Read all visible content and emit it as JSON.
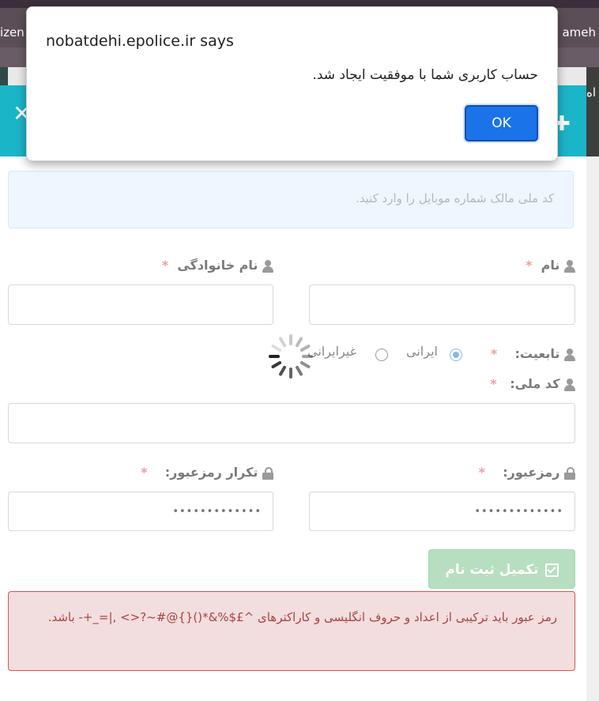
{
  "background": {
    "tab_left_text": "izen",
    "tab_right_text": "ameh",
    "right_fragment": "اه"
  },
  "modal": {
    "close_icon": "close-icon",
    "add_icon": "plus-icon",
    "info_text": "کد ملی مالک شماره موبایل را وارد کنید.",
    "first_name": {
      "label": "نام",
      "required": "*",
      "value": ""
    },
    "last_name": {
      "label": "نام خانوادگی",
      "required": "*",
      "value": ""
    },
    "nationality": {
      "label": "تابعیت:",
      "required": "*",
      "options": [
        "ایرانی",
        "غیرایرانی"
      ],
      "selected": "ایرانی"
    },
    "national_code": {
      "label": "کد ملی:",
      "required": "*",
      "value": ""
    },
    "password": {
      "label": "رمزعبور:",
      "required": "*",
      "placeholder": "•••••••••••••"
    },
    "password_repeat": {
      "label": "تکرار رمزعبور:",
      "required": "*",
      "placeholder": "•••••••••••••"
    },
    "submit_label": "تکمیل ثبت نام",
    "alert_text": "رمز عبور باید ترکیبی از اعداد و حروف انگلیسی و کاراکترهای ^£$%&*(){}@#~?<> ,|=_+- باشد."
  },
  "dialog": {
    "title": "nobatdehi.epolice.ir says",
    "message": "حساب کاربری شما با موفقیت ایجاد شد.",
    "ok_label": "OK",
    "button_color": "#1a73e8"
  },
  "colors": {
    "header": "#1bb5c8",
    "submit_disabled": "#b7dec0",
    "alert_bg": "#f2dede",
    "alert_text": "#a94442"
  }
}
